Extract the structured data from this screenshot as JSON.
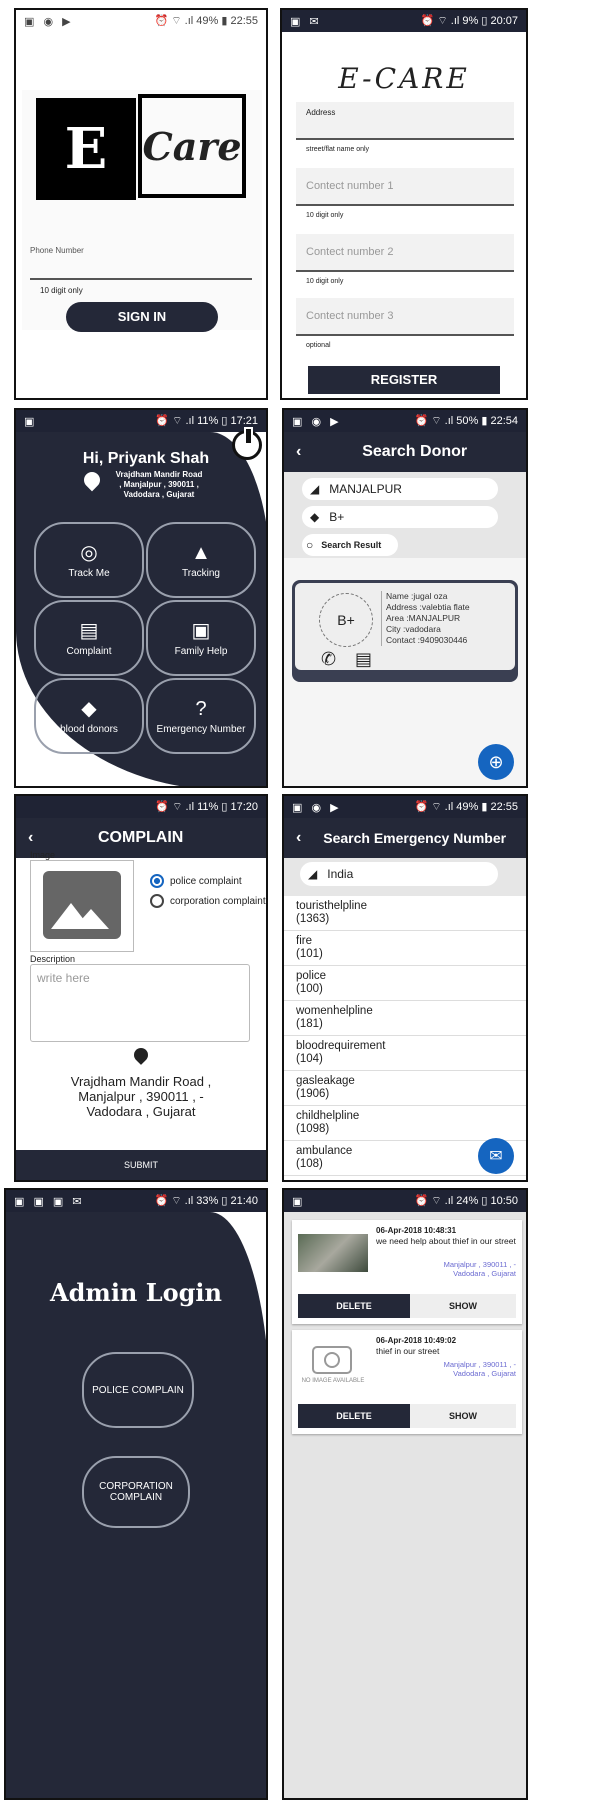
{
  "colors": {
    "navy": "#242838",
    "accent": "#1565c0"
  },
  "signin": {
    "status": {
      "left": "▣ ◉ ▶",
      "right": "⏰ ⌔ .ıl 49% ▮ 22:55"
    },
    "logo_e": "E",
    "logo_care": "Care",
    "phone_label": "Phone Number",
    "phone_hint": "10 digit only",
    "button": "SIGN IN"
  },
  "register": {
    "status": {
      "left": "▣ ✉",
      "right": "⏰ ⌔ .ıl 9% ▯ 20:07"
    },
    "title": "E-CARE",
    "address_label": "Address",
    "address_hint": "street/flat name only",
    "c1_placeholder": "Contect number 1",
    "c1_hint": "10 digit only",
    "c2_placeholder": "Contect number 2",
    "c2_hint": "10 digit only",
    "c3_placeholder": "Contect number 3",
    "c3_hint": "optional",
    "button": "REGISTER"
  },
  "home": {
    "status": {
      "left": "▣",
      "right": "⏰ ⌔ .ıl 11% ▯ 17:21"
    },
    "greeting": "Hi, Priyank Shah",
    "address": "Vrajdham Mandir Road , Manjalpur , 390011 , Vadodara , Gujarat",
    "buttons": {
      "track": "Track Me",
      "tracking": "Tracking",
      "complaint": "Complaint",
      "family": "Family Help",
      "blood": "blood donors",
      "emergency": "Emergency Number"
    }
  },
  "donor": {
    "status": {
      "left": "▣ ◉ ▶",
      "right": "⏰ ⌔ .ıl 50% ▮ 22:54"
    },
    "title": "Search Donor",
    "back": "‹",
    "area": "MANJALPUR",
    "blood": "B+",
    "search": "Search Result",
    "result": {
      "group": "B+",
      "name": "Name :jugal oza",
      "address": "Address :valebtia flate",
      "area": "Area :MANJALPUR",
      "city": "City :vadodara",
      "contact": "Contact :9409030446"
    },
    "fab": "⊕"
  },
  "complain": {
    "status": {
      "left": "",
      "right": "⏰ ⌔ .ıl 11% ▯ 17:20"
    },
    "back": "‹",
    "title": "COMPLAIN",
    "image_label": "Image",
    "opt1": "police complaint",
    "opt2": "corporation complaint",
    "desc_label": "Description",
    "desc_placeholder": "write here",
    "address": "Vrajdham Mandir Road , Manjalpur , 390011 , - Vadodara , Gujarat",
    "submit": "SUBMIT"
  },
  "emergency": {
    "status": {
      "left": "▣ ◉ ▶",
      "right": "⏰ ⌔ .ıl 49% ▮ 22:55"
    },
    "back": "‹",
    "title": "Search Emergency Number",
    "country": "India",
    "items": [
      {
        "name": "touristhelpline",
        "num": "(1363)"
      },
      {
        "name": "fire",
        "num": "(101)"
      },
      {
        "name": "police",
        "num": "(100)"
      },
      {
        "name": "womenhelpline",
        "num": "(181)"
      },
      {
        "name": "bloodrequirement",
        "num": "(104)"
      },
      {
        "name": "gasleakage",
        "num": "(1906)"
      },
      {
        "name": "childhelpline",
        "num": "(1098)"
      },
      {
        "name": "ambulance",
        "num": "(108)"
      }
    ],
    "fab": "✉"
  },
  "admin": {
    "status": {
      "left": "▣ ▣ ▣ ✉",
      "right": "⏰ ⌔ .ıl 33% ▯ 21:40"
    },
    "title": "Admin Login",
    "police": "POLICE COMPLAIN",
    "corporation": "CORPORATION COMPLAIN"
  },
  "list": {
    "status": {
      "left": "▣",
      "right": "⏰ ⌔ .ıl 24% ▯ 10:50"
    },
    "cards": [
      {
        "date": "06-Apr-2018 10:48:31",
        "text": "we need help about thief in our street",
        "loc": "Manjalpur , 390011 , - Vadodara , Gujarat",
        "delete": "DELETE",
        "show": "SHOW",
        "noimg": ""
      },
      {
        "date": "06-Apr-2018 10:49:02",
        "text": "thief in our street",
        "loc": "Manjalpur , 390011 , - Vadodara , Gujarat",
        "delete": "DELETE",
        "show": "SHOW",
        "noimg": "NO IMAGE AVAILABLE"
      }
    ]
  }
}
